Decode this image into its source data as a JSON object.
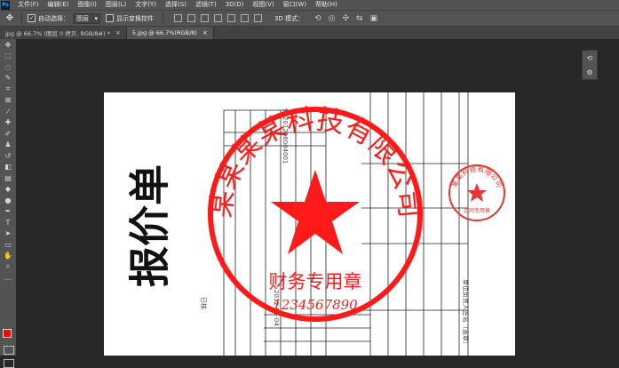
{
  "app": {
    "logo": "Ps",
    "menu": [
      "文件(F)",
      "编辑(E)",
      "图像(I)",
      "图层(L)",
      "文字(Y)",
      "选择(S)",
      "滤镜(T)",
      "3D(D)",
      "视图(V)",
      "窗口(W)",
      "帮助(H)"
    ]
  },
  "options": {
    "auto_select_label": "自动选择：",
    "auto_select_value": "图层",
    "show_transform_label": "显示变换控件",
    "mode3d_label": "3D 模式："
  },
  "tabs": [
    {
      "label": "jpg @ 66.7% (图层 0 拷贝, RGB/8#) *",
      "active": false
    },
    {
      "label": "5.jpg @ 66.7%(RGB/8)",
      "active": true
    }
  ],
  "document": {
    "title": "报价单",
    "big_stamp": {
      "company": "某某某某科技有限公司",
      "purpose": "财务专用章",
      "number": "1234567890",
      "color": "#ff1a1a"
    },
    "small_stamp": {
      "company": "某某科技有限公司",
      "purpose": "合同专用章",
      "color": "#e8362f"
    },
    "form_texts": {
      "doc_number": "91201206004001",
      "date": "2012-06-04",
      "label_a": "已核",
      "label_b": "日期：",
      "label_c": "单位负责人签名（盖章）"
    }
  },
  "colors": {
    "foreground": "#ff0000",
    "background": "#000000"
  }
}
